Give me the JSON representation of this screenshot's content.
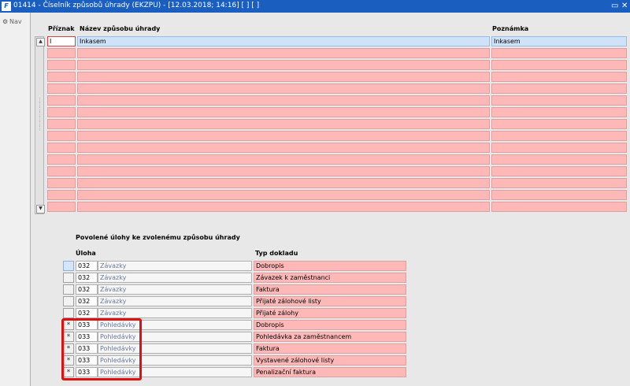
{
  "window": {
    "app_icon": "F",
    "title": "01414 - Číselník způsobů úhrady (EKZPU) - [12.03.2018; 14:16]  [ ]  [ ]",
    "restore_glyph": "▭",
    "close_glyph": "✕"
  },
  "nav": {
    "label": "Nav",
    "icon": "nav-gear-icon",
    "icon_glyph": "⚙"
  },
  "top_grid": {
    "headers": {
      "flag": "Příznak",
      "name": "Název způsobu úhrady",
      "note": "Poznámka"
    },
    "scroll_up": "▲",
    "scroll_down": "▼",
    "rows": [
      {
        "flag": "I",
        "name": "Inkasem",
        "note": "Inkasem"
      },
      {
        "flag": "",
        "name": "",
        "note": ""
      },
      {
        "flag": "",
        "name": "",
        "note": ""
      },
      {
        "flag": "",
        "name": "",
        "note": ""
      },
      {
        "flag": "",
        "name": "",
        "note": ""
      },
      {
        "flag": "",
        "name": "",
        "note": ""
      },
      {
        "flag": "",
        "name": "",
        "note": ""
      },
      {
        "flag": "",
        "name": "",
        "note": ""
      },
      {
        "flag": "",
        "name": "",
        "note": ""
      },
      {
        "flag": "",
        "name": "",
        "note": ""
      },
      {
        "flag": "",
        "name": "",
        "note": ""
      },
      {
        "flag": "",
        "name": "",
        "note": ""
      },
      {
        "flag": "",
        "name": "",
        "note": ""
      },
      {
        "flag": "",
        "name": "",
        "note": ""
      },
      {
        "flag": "",
        "name": "",
        "note": ""
      }
    ]
  },
  "bottom_section": {
    "title": "Povolené úlohy ke zvolenému způsobu úhrady",
    "headers": {
      "task": "Úloha",
      "doc_type": "Typ dokladu"
    },
    "rows": [
      {
        "mark": "",
        "code": "032",
        "name": "Závazky",
        "doc_type": "Dobropis"
      },
      {
        "mark": "",
        "code": "032",
        "name": "Závazky",
        "doc_type": "Závazek k zaměstnanci"
      },
      {
        "mark": "",
        "code": "032",
        "name": "Závazky",
        "doc_type": "Faktura"
      },
      {
        "mark": "",
        "code": "032",
        "name": "Závazky",
        "doc_type": "Přijaté zálohové listy"
      },
      {
        "mark": "",
        "code": "032",
        "name": "Závazky",
        "doc_type": "Přijaté zálohy"
      },
      {
        "mark": "*",
        "code": "033",
        "name": "Pohledávky",
        "doc_type": "Dobropis"
      },
      {
        "mark": "*",
        "code": "033",
        "name": "Pohledávky",
        "doc_type": "Pohledávka za zaměstnancem"
      },
      {
        "mark": "*",
        "code": "033",
        "name": "Pohledávky",
        "doc_type": "Faktura"
      },
      {
        "mark": "*",
        "code": "033",
        "name": "Pohledávky",
        "doc_type": "Vystavené zálohové listy"
      },
      {
        "mark": "*",
        "code": "033",
        "name": "Pohledávky",
        "doc_type": "Penalizační faktura"
      }
    ]
  },
  "colors": {
    "titlebar": "#1a5fbf",
    "required_cell": "#ffb8b8",
    "selected_row": "#cfe3f8",
    "highlight": "#e01010"
  }
}
